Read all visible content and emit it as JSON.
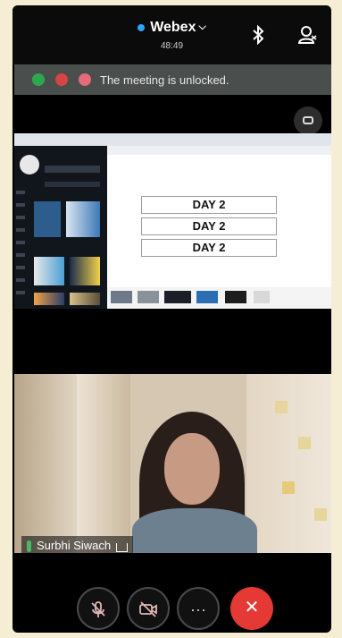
{
  "header": {
    "app_name": "Webex",
    "chevron": "⌵",
    "timer": "48:49",
    "icons": [
      "bluetooth-icon",
      "participants-icon"
    ]
  },
  "banner": {
    "text": "The meeting is unlocked."
  },
  "shared_screen": {
    "slide_texts": [
      "DAY 2",
      "DAY 2",
      "DAY 2"
    ]
  },
  "participant": {
    "name": "Surbhi Siwach"
  },
  "controls": {
    "icons": [
      "mute-mic-icon",
      "video-off-icon",
      "more-icon",
      "end-call-icon"
    ],
    "more_label": "···",
    "end_label": "✕"
  },
  "colors": {
    "end_call": "#e53935",
    "accent": "#2fa3ff",
    "banner_bg": "#4a4e4c",
    "frame_bg": "#f6eed4"
  }
}
